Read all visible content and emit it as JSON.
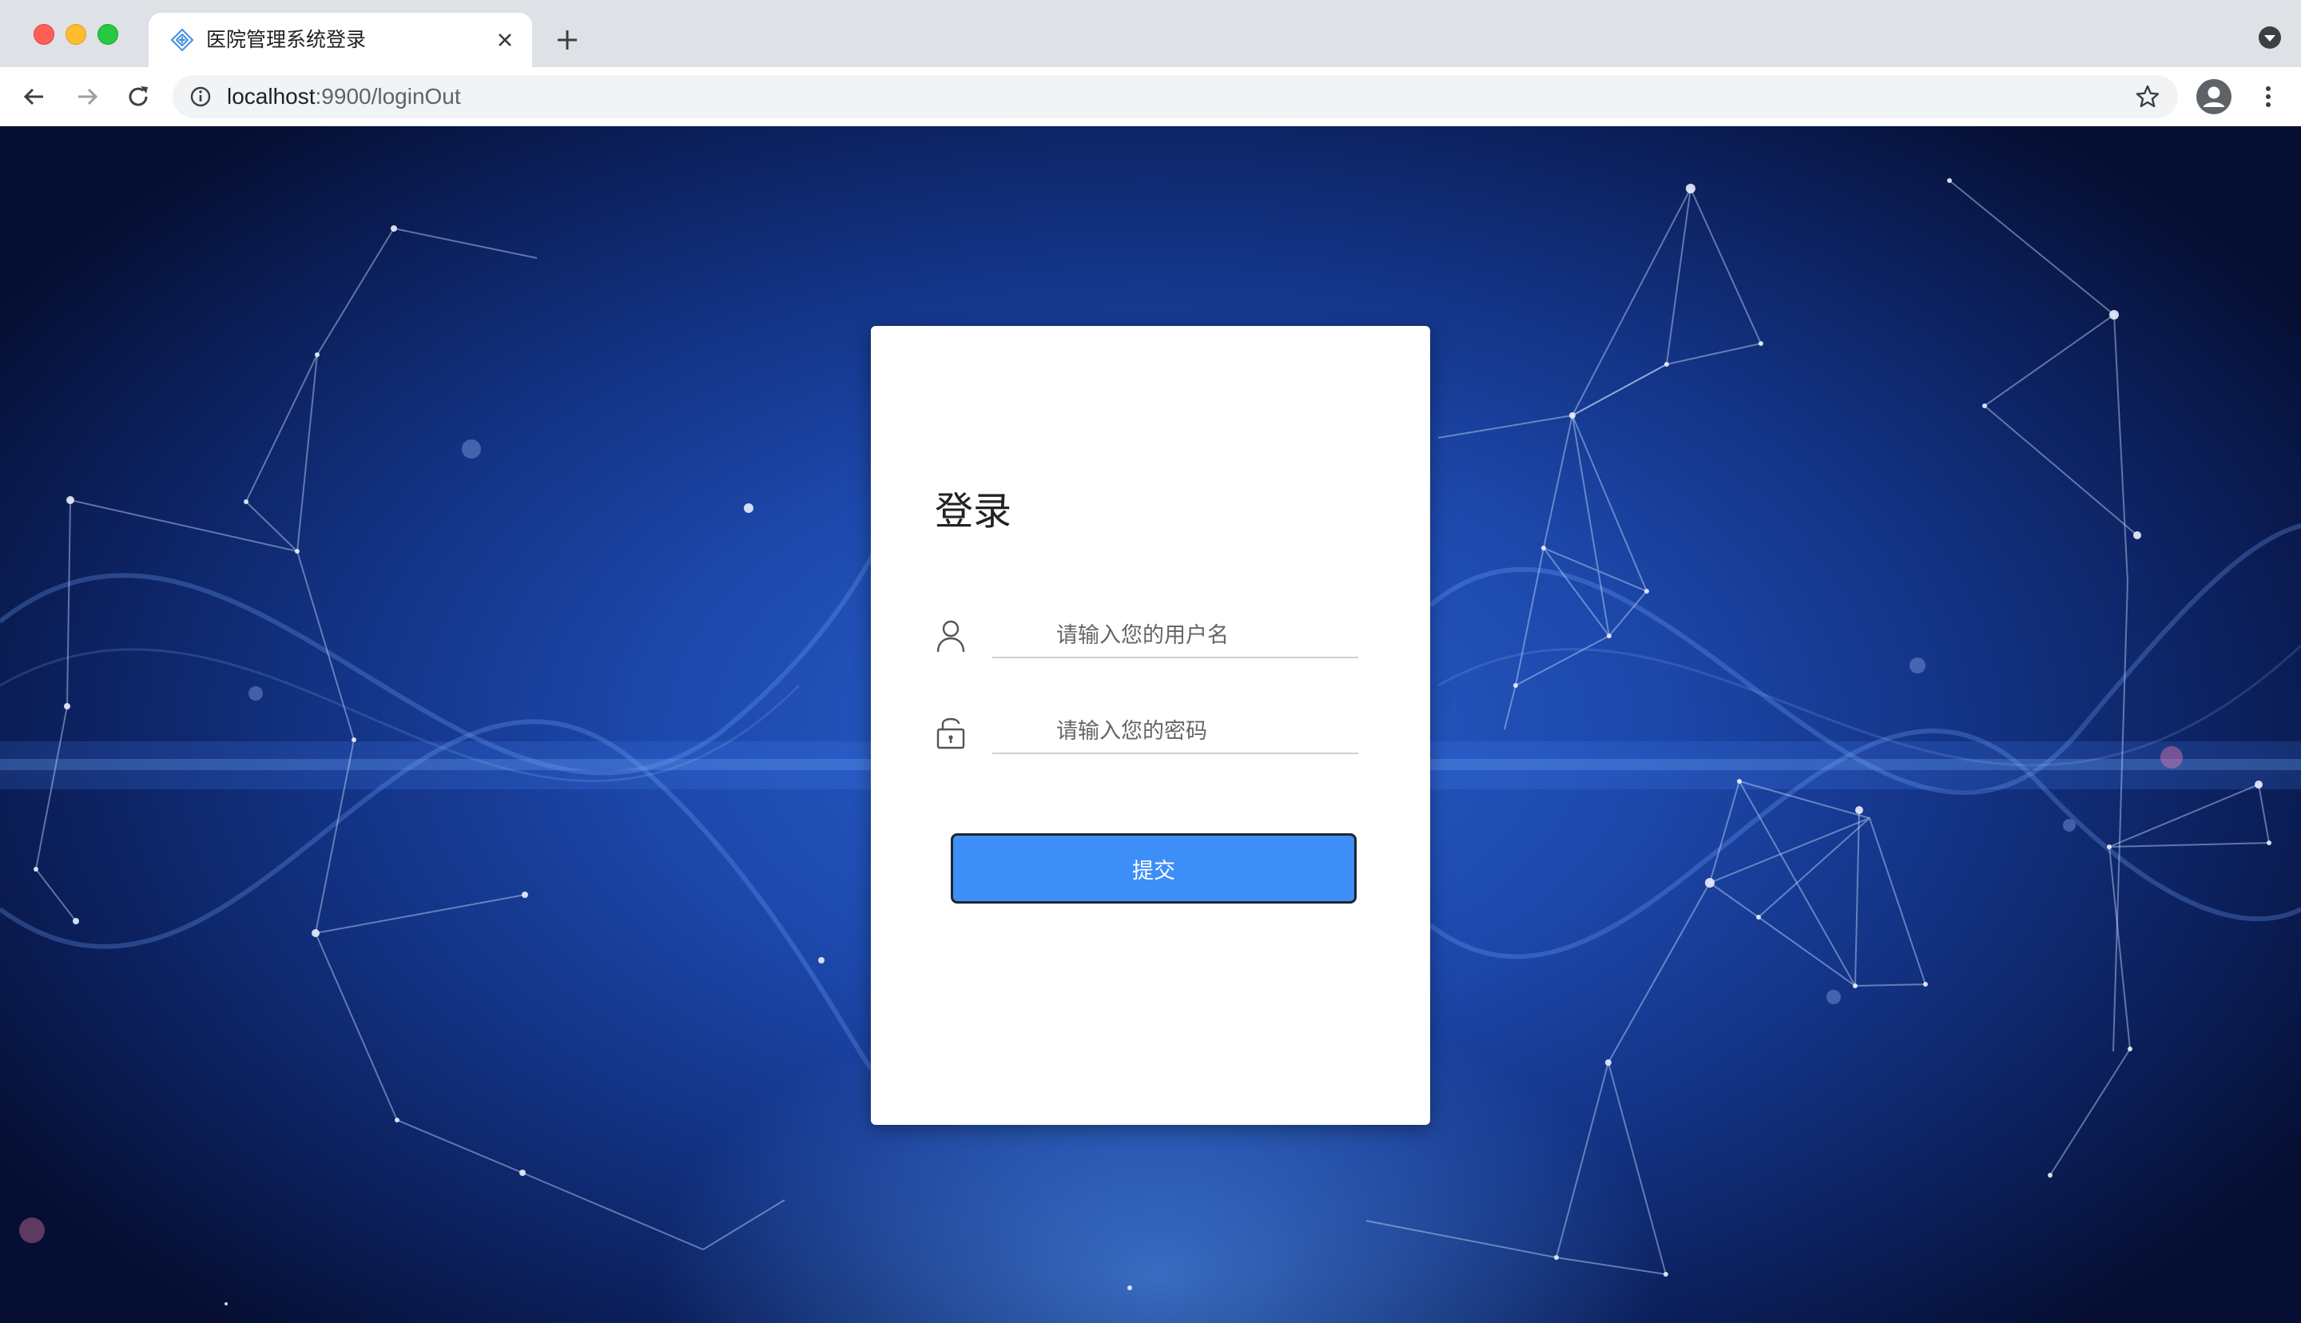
{
  "browser": {
    "tab_title": "医院管理系统登录",
    "url_host": "localhost",
    "url_rest": ":9900/loginOut"
  },
  "login": {
    "title": "登录",
    "username_placeholder": "请输入您的用户名",
    "password_placeholder": "请输入您的密码",
    "submit_label": "提交"
  },
  "colors": {
    "button": "#3e8ef7",
    "background_dark": "#0b1f5a",
    "background_light": "#2a5fc9"
  },
  "icons": {
    "username": "user-icon",
    "password": "lock-icon"
  }
}
